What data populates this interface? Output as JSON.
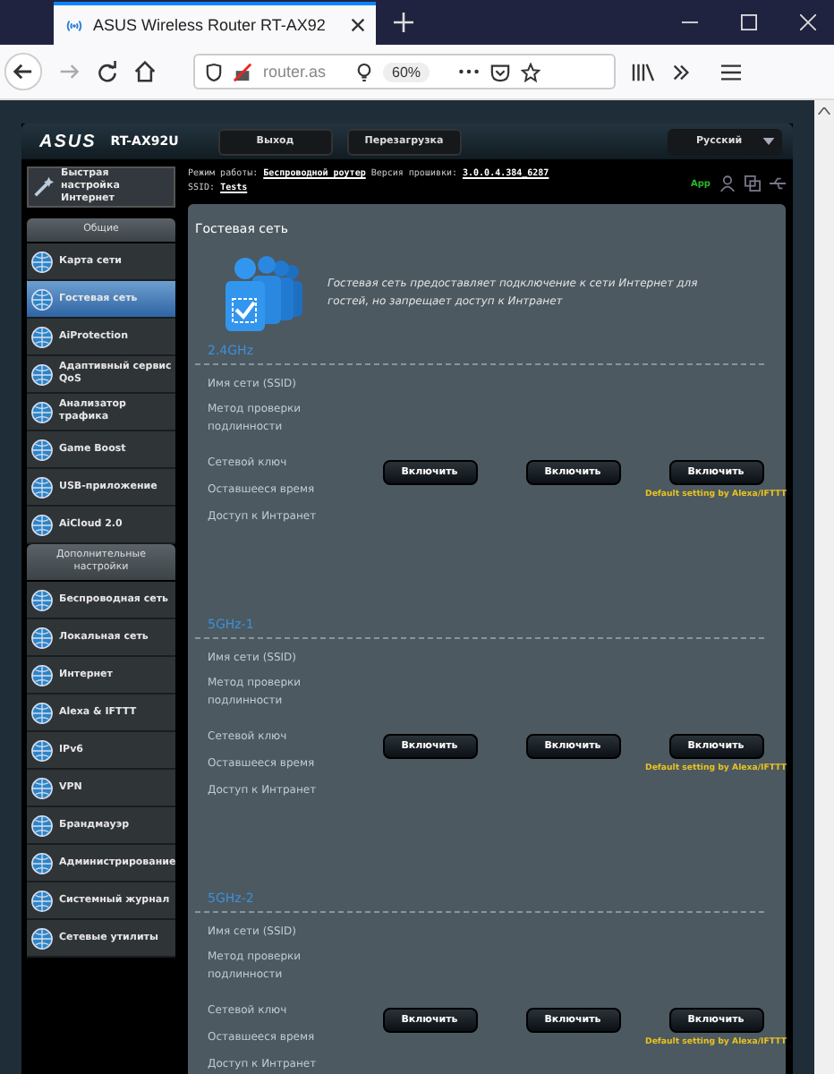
{
  "browser": {
    "tab_title": "ASUS Wireless Router RT-AX92",
    "url": "router.as",
    "zoom": "60%"
  },
  "header": {
    "logo": "ASUS",
    "model": "RT-AX92U",
    "buttons": [
      "Выход",
      "Перезагрузка"
    ],
    "language": "Русский"
  },
  "info": {
    "mode_label": "Режим работы:",
    "mode": "Беспроводной роутер",
    "fw_label": "Версия прошивки:",
    "fw": "3.0.0.4.384_6287",
    "ssid_label": "SSID:",
    "ssid": "Tests",
    "app": "App"
  },
  "sidebar": {
    "quick_setup": "Быстрая настройка Интернет",
    "groups": [
      {
        "title": "Общие",
        "items": [
          {
            "label": "Карта сети",
            "selected": false
          },
          {
            "label": "Гостевая сеть",
            "selected": true
          },
          {
            "label": "AiProtection",
            "selected": false
          },
          {
            "label": "Адаптивный сервис QoS",
            "selected": false
          },
          {
            "label": "Анализатор трафика",
            "selected": false
          },
          {
            "label": "Game Boost",
            "selected": false
          },
          {
            "label": "USB-приложение",
            "selected": false
          },
          {
            "label": "AiCloud 2.0",
            "selected": false
          }
        ]
      },
      {
        "title": "Дополнительные настройки",
        "items": [
          {
            "label": "Беспроводная сеть",
            "selected": false
          },
          {
            "label": "Локальная сеть",
            "selected": false
          },
          {
            "label": "Интернет",
            "selected": false
          },
          {
            "label": "Alexa & IFTTT",
            "selected": false
          },
          {
            "label": "IPv6",
            "selected": false
          },
          {
            "label": "VPN",
            "selected": false
          },
          {
            "label": "Брандмауэр",
            "selected": false
          },
          {
            "label": "Администрирование",
            "selected": false
          },
          {
            "label": "Системный журнал",
            "selected": false
          },
          {
            "label": "Сетевые утилиты",
            "selected": false
          }
        ]
      }
    ]
  },
  "page": {
    "title": "Гостевая сеть",
    "description": "Гостевая сеть предоставляет подключение к сети Интернет для гостей, но запрещает доступ к Интранет",
    "bands": [
      {
        "name": "2.4GHz",
        "fields": [
          "Имя сети (SSID)",
          "Метод проверки подлинности",
          "Сетевой ключ",
          "Оставшееся время",
          "Доступ к Интранет"
        ],
        "buttons": [
          {
            "label": "Включить"
          },
          {
            "label": "Включить"
          },
          {
            "label": "Включить",
            "note": "Default setting by Alexa/IFTTT"
          }
        ]
      },
      {
        "name": "5GHz-1",
        "fields": [
          "Имя сети (SSID)",
          "Метод проверки подлинности",
          "Сетевой ключ",
          "Оставшееся время",
          "Доступ к Интранет"
        ],
        "buttons": [
          {
            "label": "Включить"
          },
          {
            "label": "Включить"
          },
          {
            "label": "Включить",
            "note": "Default setting by Alexa/IFTTT"
          }
        ]
      },
      {
        "name": "5GHz-2",
        "fields": [
          "Имя сети (SSID)",
          "Метод проверки подлинности",
          "Сетевой ключ",
          "Оставшееся время",
          "Доступ к Интранет"
        ],
        "buttons": [
          {
            "label": "Включить"
          },
          {
            "label": "Включить"
          },
          {
            "label": "Включить",
            "note": "Default setting by Alexa/IFTTT"
          }
        ]
      }
    ]
  }
}
